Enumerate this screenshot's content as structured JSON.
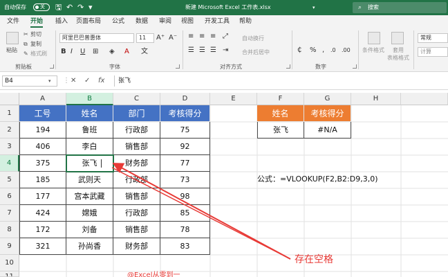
{
  "titlebar": {
    "autosave_label": "自动保存",
    "autosave_state": "关",
    "doc_title": "新建 Microsoft Excel 工作表.xlsx",
    "search_label": "搜索"
  },
  "tabs": [
    "文件",
    "开始",
    "插入",
    "页面布局",
    "公式",
    "数据",
    "审阅",
    "视图",
    "开发工具",
    "帮助"
  ],
  "active_tab": "开始",
  "ribbon": {
    "clipboard": {
      "paste": "粘贴",
      "cut": "剪切",
      "copy": "复制",
      "format_painter": "格式刷",
      "label": "剪贴板"
    },
    "font": {
      "name": "阿里巴巴普惠体",
      "size": "11",
      "bold": "B",
      "italic": "I",
      "underline": "U",
      "label": "字体"
    },
    "alignment": {
      "wrap_text": "自动换行",
      "merge_center": "合并后居中",
      "label": "对齐方式"
    },
    "number": {
      "format": "常规",
      "label": "数字"
    },
    "styles": {
      "conditional": "条件格式",
      "format_table": "套用\n表格格式"
    },
    "calc": {
      "label": "计算"
    }
  },
  "formula_bar": {
    "cell_ref": "B4",
    "value": "张飞"
  },
  "grid": {
    "columns": [
      "A",
      "B",
      "C",
      "D",
      "E",
      "F",
      "G",
      "H"
    ],
    "rows": [
      "1",
      "2",
      "3",
      "4",
      "5",
      "6",
      "7",
      "8",
      "9",
      "10",
      "11"
    ],
    "table_headers": [
      "工号",
      "姓名",
      "部门",
      "考核得分"
    ],
    "table_rows": [
      [
        "194",
        "鲁班",
        "行政部",
        "75"
      ],
      [
        "406",
        "李白",
        "销售部",
        "92"
      ],
      [
        "375",
        "张飞",
        "财务部",
        "77"
      ],
      [
        "185",
        "武则天",
        "行政部",
        "73"
      ],
      [
        "177",
        "宫本武藏",
        "销售部",
        "98"
      ],
      [
        "424",
        "嫦娥",
        "行政部",
        "85"
      ],
      [
        "172",
        "刘备",
        "销售部",
        "78"
      ],
      [
        "321",
        "孙尚香",
        "财务部",
        "83"
      ]
    ],
    "lookup_headers": [
      "姓名",
      "考核得分"
    ],
    "lookup_row": [
      "张飞",
      "#N/A"
    ]
  },
  "annotations": {
    "formula_text": "公式：=VLOOKUP(F2,B2:D9,3,0)",
    "callout": "存在空格",
    "watermark": "@Excel从零到一"
  },
  "colors": {
    "excel_green": "#217346",
    "blue_header": "#4472c4",
    "orange_header": "#ed7d31",
    "arrow_red": "#e83a36"
  }
}
